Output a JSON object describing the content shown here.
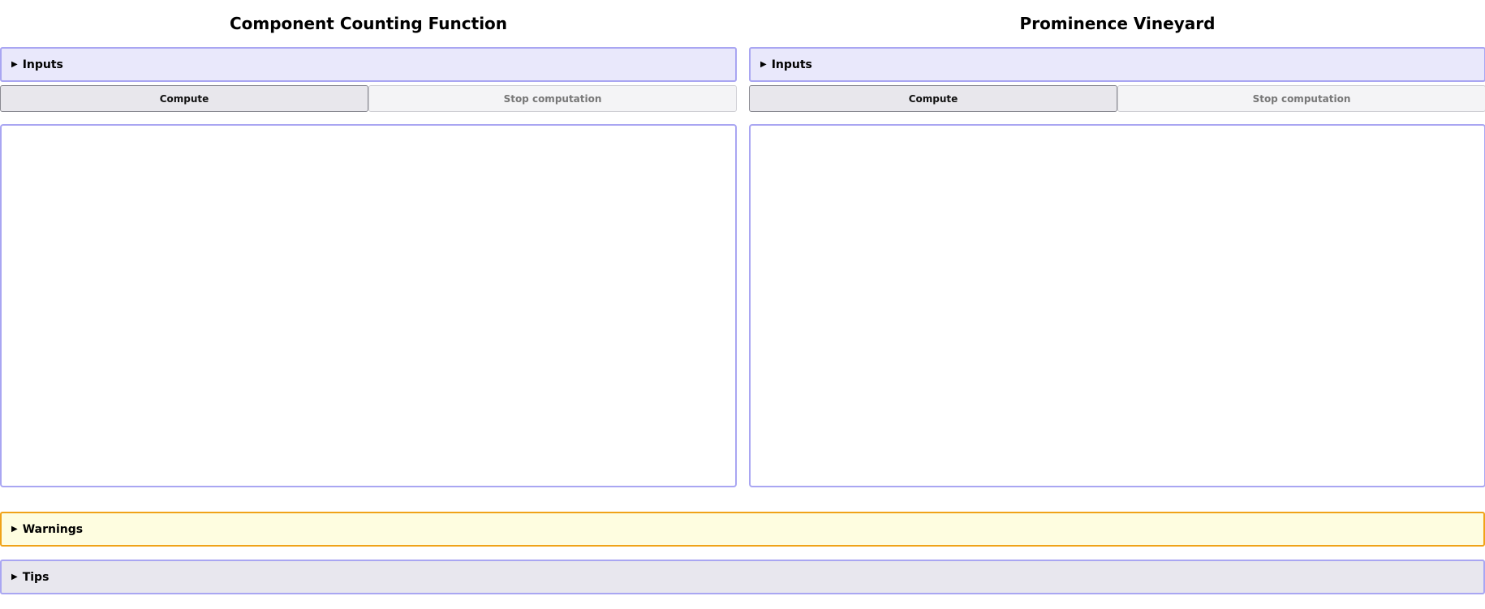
{
  "panels": [
    {
      "title": "Component Counting Function",
      "inputs_label": "Inputs",
      "compute_label": "Compute",
      "stop_label": "Stop computation"
    },
    {
      "title": "Prominence Vineyard",
      "inputs_label": "Inputs",
      "compute_label": "Compute",
      "stop_label": "Stop computation"
    }
  ],
  "warnings": {
    "label": "Warnings"
  },
  "tips": {
    "label": "Tips"
  },
  "colors": {
    "accent_border": "#a9a6f2",
    "inputs_bg": "#e9e8fb",
    "warning_border": "#f0a318",
    "warning_bg": "#fefde0",
    "tips_bg": "#e8e7ee"
  },
  "icons": {
    "disclosure": "triangle-right-icon"
  }
}
